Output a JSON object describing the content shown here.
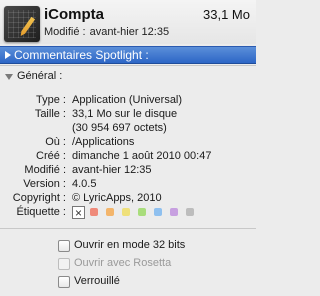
{
  "header": {
    "app_name": "iCompta",
    "size": "33,1 Mo",
    "modified_label": "Modifié :",
    "modified_value": "avant-hier 12:35",
    "icon": "icompta-app-icon"
  },
  "spotlight": {
    "label": "Commentaires Spotlight :",
    "icon": "disclosure-triangle-right-icon"
  },
  "general": {
    "title": "Général :",
    "icon": "disclosure-triangle-down-icon",
    "rows": [
      {
        "key": "Type :",
        "value": "Application (Universal)"
      },
      {
        "key": "Taille :",
        "value": "33,1 Mo sur le disque"
      },
      {
        "key": "",
        "value": "(30 954 697 octets)"
      },
      {
        "key": "Où :",
        "value": "/Applications"
      },
      {
        "key": "Créé :",
        "value": "dimanche 1 août 2010 00:47"
      },
      {
        "key": "Modifié :",
        "value": "avant-hier 12:35"
      },
      {
        "key": "Version :",
        "value": "4.0.5"
      },
      {
        "key": "Copyright :",
        "value": "© LyricApps, 2010"
      }
    ],
    "label_key": "Étiquette :",
    "label_none": "×",
    "label_colors": [
      "#ef8a7a",
      "#f3b56b",
      "#efe07a",
      "#a9dd7c",
      "#8fc0ef",
      "#c7a0e0",
      "#bdbdbd"
    ]
  },
  "checkboxes": [
    {
      "label": "Ouvrir en mode 32 bits",
      "checked": false,
      "enabled": true
    },
    {
      "label": "Ouvrir avec Rosetta",
      "checked": false,
      "enabled": false
    },
    {
      "label": "Verrouillé",
      "checked": false,
      "enabled": true
    }
  ]
}
